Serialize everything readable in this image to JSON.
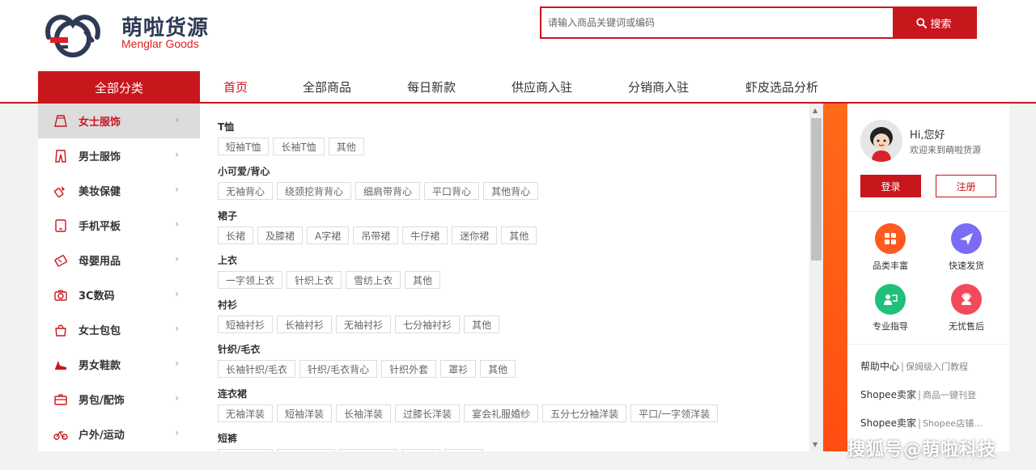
{
  "brand": {
    "name_cn": "萌啦货源",
    "name_en": "Menglar Goods"
  },
  "search": {
    "placeholder": "请输入商品关键词或编码",
    "button": "搜索"
  },
  "nav": {
    "category_title": "全部分类",
    "items": [
      "首页",
      "全部商品",
      "每日新款",
      "供应商入驻",
      "分销商入驻",
      "虾皮选品分析"
    ],
    "active": "首页"
  },
  "sidebar": {
    "items": [
      {
        "label": "女士服饰",
        "icon": "skirt-icon"
      },
      {
        "label": "男士服饰",
        "icon": "pants-icon"
      },
      {
        "label": "美妆保健",
        "icon": "lipstick-icon"
      },
      {
        "label": "手机平板",
        "icon": "phone-icon"
      },
      {
        "label": "母婴用品",
        "icon": "baby-icon"
      },
      {
        "label": "3C数码",
        "icon": "camera-icon"
      },
      {
        "label": "女士包包",
        "icon": "handbag-icon"
      },
      {
        "label": "男女鞋款",
        "icon": "shoe-icon"
      },
      {
        "label": "男包/配饰",
        "icon": "briefcase-icon"
      },
      {
        "label": "户外/运动",
        "icon": "bicycle-icon"
      }
    ],
    "arrow": "›"
  },
  "categories": [
    {
      "title": "T恤",
      "tags": [
        "短袖T恤",
        "长袖T恤",
        "其他"
      ]
    },
    {
      "title": "小可爱/背心",
      "tags": [
        "无袖背心",
        "绕颈挖背背心",
        "细肩带背心",
        "平口背心",
        "其他背心"
      ]
    },
    {
      "title": "裙子",
      "tags": [
        "长裙",
        "及膝裙",
        "A字裙",
        "吊带裙",
        "牛仔裙",
        "迷你裙",
        "其他"
      ]
    },
    {
      "title": "上衣",
      "tags": [
        "一字领上衣",
        "针织上衣",
        "雪纺上衣",
        "其他"
      ]
    },
    {
      "title": "衬衫",
      "tags": [
        "短袖衬衫",
        "长袖衬衫",
        "无袖衬衫",
        "七分袖衬衫",
        "其他"
      ]
    },
    {
      "title": "针织/毛衣",
      "tags": [
        "长袖针织/毛衣",
        "针织/毛衣背心",
        "针织外套",
        "罩衫",
        "其他"
      ]
    },
    {
      "title": "连衣裙",
      "tags": [
        "无袖洋装",
        "短袖洋装",
        "长袖洋装",
        "过膝长洋装",
        "宴会礼服婚纱",
        "五分七分袖洋装",
        "平口/一字领洋装"
      ]
    },
    {
      "title": "短裤",
      "tags": [
        "",
        "",
        "",
        "",
        ""
      ]
    }
  ],
  "user": {
    "greeting": "Hi,您好",
    "welcome": "欢迎来到萌啦货源",
    "login": "登录",
    "register": "注册"
  },
  "features": [
    {
      "label": "品类丰富",
      "icon": "grid-icon",
      "color": "#ff5a1f"
    },
    {
      "label": "快速发货",
      "icon": "plane-icon",
      "color": "#7b6cf6"
    },
    {
      "label": "专业指导",
      "icon": "teacher-icon",
      "color": "#1ec07a"
    },
    {
      "label": "无忧售后",
      "icon": "support-icon",
      "color": "#f24a5a"
    }
  ],
  "help": [
    {
      "main": "帮助中心",
      "sub": "保姆级入门教程"
    },
    {
      "main": "Shopee卖家",
      "sub": "商品一键刊登"
    },
    {
      "main": "Shopee卖家",
      "sub": "Shopee店铺..."
    }
  ],
  "watermark": "搜狐号@萌啦科技",
  "colors": {
    "brand_red": "#c8161d",
    "orange": "#ff5a1f",
    "active_bg": "#dcdcdc"
  }
}
